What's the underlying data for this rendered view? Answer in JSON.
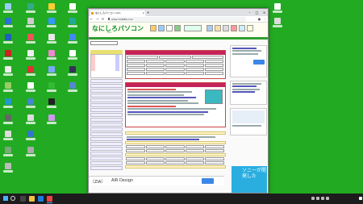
{
  "browser": {
    "tab_title": "なにしろパソコン.com",
    "tab_close": "×",
    "new_tab": "+",
    "url": "www.724685.com",
    "win_minimize": "–",
    "win_maximize": "□",
    "win_close": "×",
    "back": "←",
    "forward": "→",
    "reload": "⟳",
    "menu": "⋮"
  },
  "site": {
    "logo": "なにしろパソコン",
    "logo_sub": ".com",
    "search_value": "",
    "calendar_header": "",
    "main_header_1": "",
    "main_header_2": ""
  },
  "ad": {
    "logo_text": "〔ZIA〕",
    "name": "AIR Design",
    "button_label": ""
  },
  "sony": {
    "text": "ソニーが開発した"
  },
  "colors": {
    "desktop": "#22aa22",
    "brand_green": "#0f8f2f",
    "header_red": "#c4235a",
    "taskbar": "#1c1c1c",
    "accent_blue": "#3b87e6"
  }
}
